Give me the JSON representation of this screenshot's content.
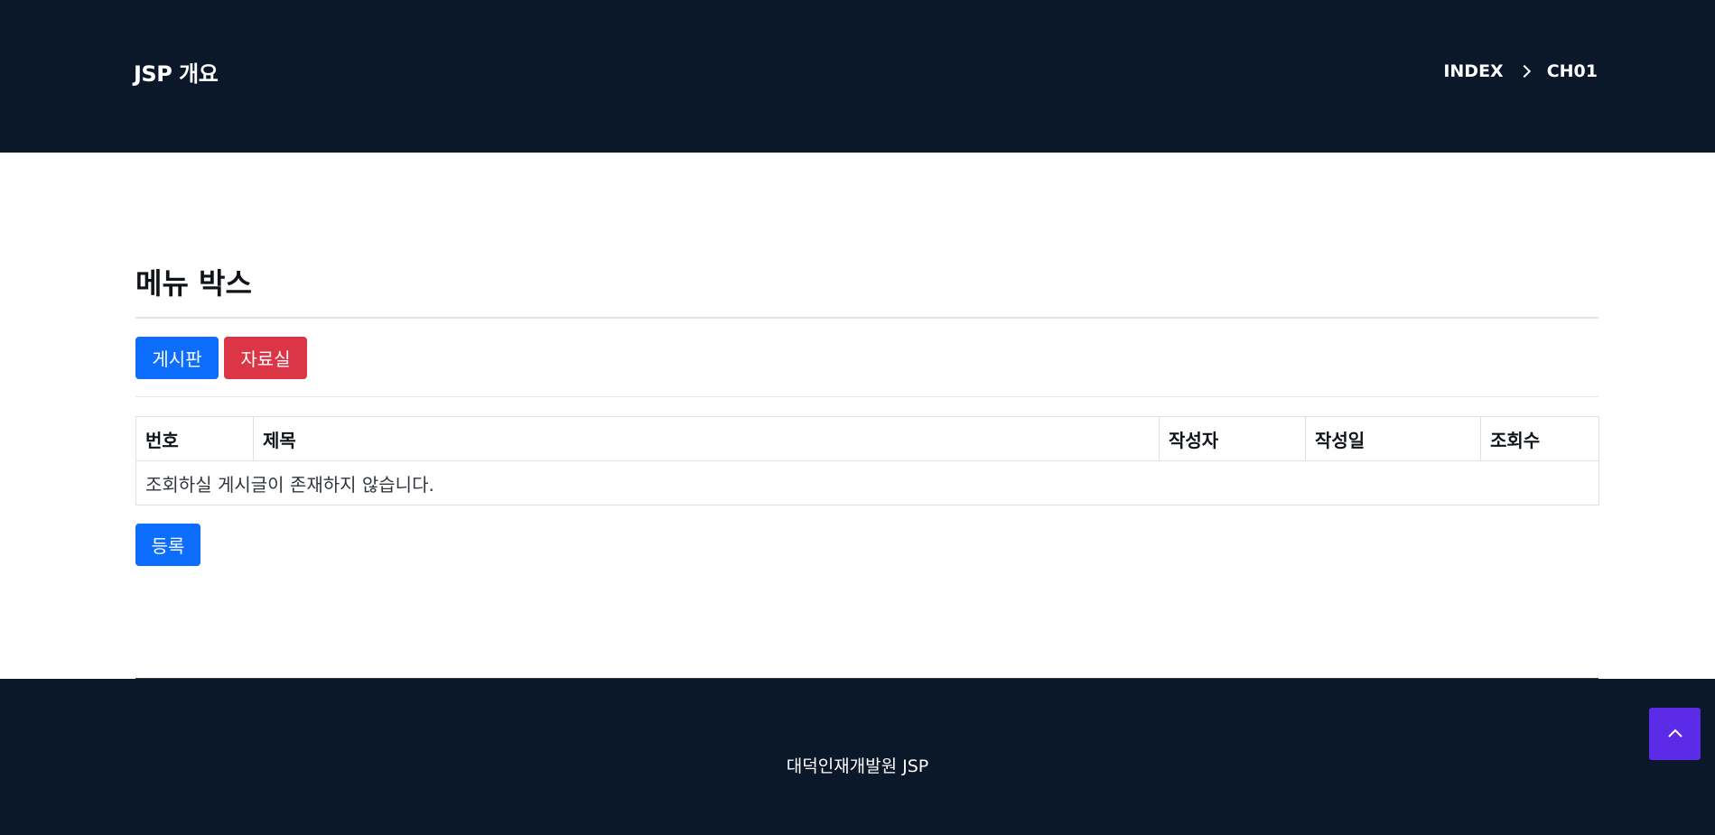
{
  "header": {
    "title": "JSP 개요",
    "breadcrumb": [
      "INDEX",
      "CH01"
    ]
  },
  "main": {
    "title": "메뉴 박스",
    "menu_buttons": [
      "게시판",
      "자료실"
    ],
    "table": {
      "headers": [
        "번호",
        "제목",
        "작성자",
        "작성일",
        "조회수"
      ],
      "empty_message": "조회하실 게시글이 존재하지 않습니다."
    },
    "register_label": "등록"
  },
  "footer": {
    "text": "대덕인재개발원 JSP"
  },
  "colors": {
    "header_bg": "#0a1829",
    "primary": "#0d6efd",
    "danger": "#dc3545",
    "scroll_top_bg": "#5b2be8"
  },
  "icons": {
    "breadcrumb_separator": "chevron-right-icon",
    "scroll_top": "chevron-up-icon"
  }
}
